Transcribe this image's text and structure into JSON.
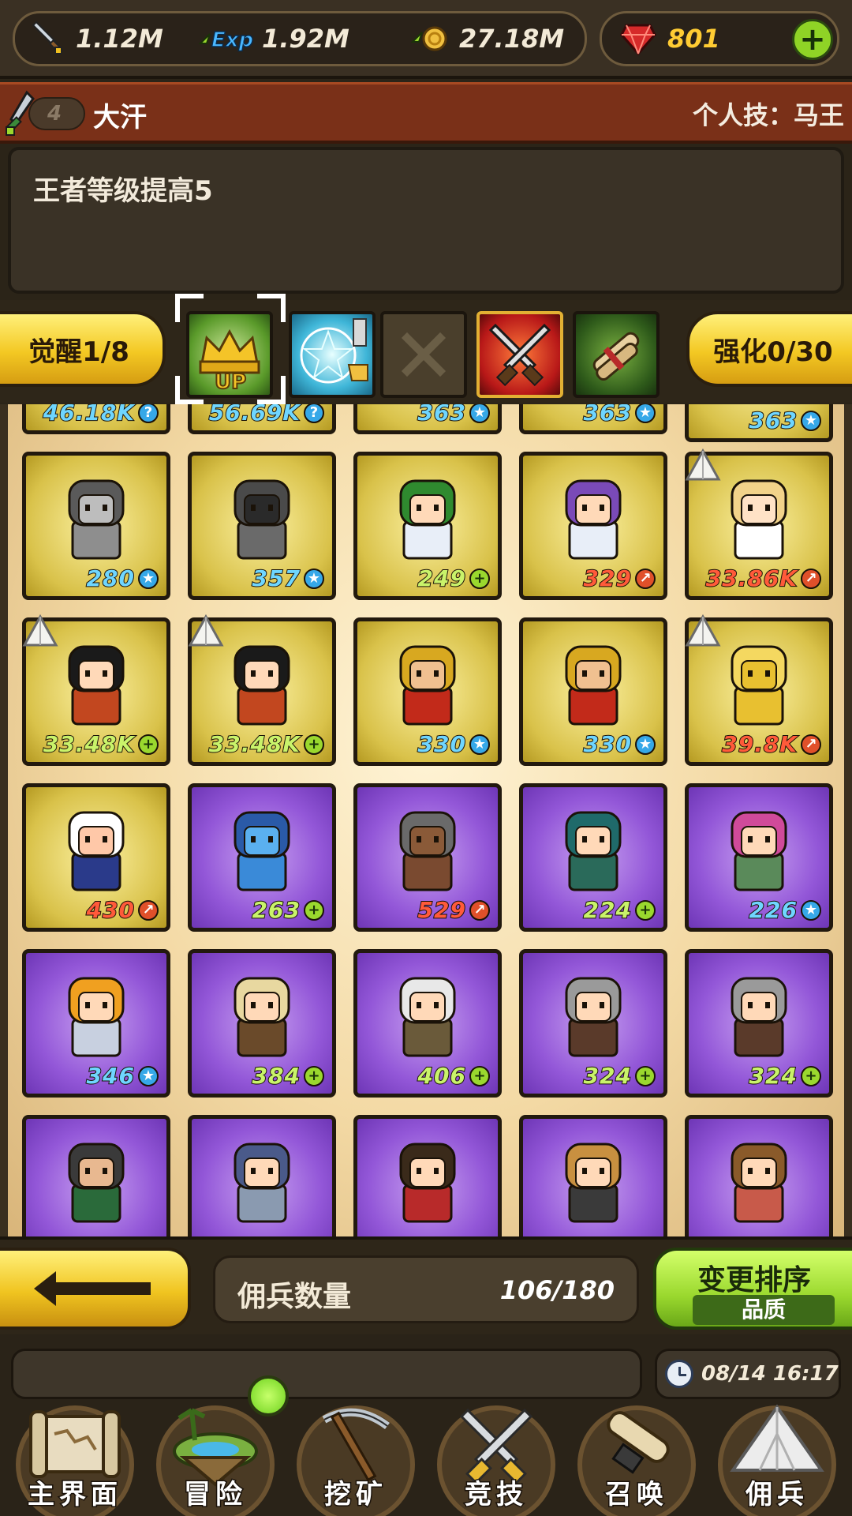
{
  "resources": {
    "attack": {
      "icon": "sword-icon",
      "value": "1.12M"
    },
    "exp": {
      "icon": "exp-icon",
      "value": "1.92M"
    },
    "gold": {
      "icon": "gold-icon",
      "value": "27.18M"
    },
    "gems": {
      "icon": "ruby-icon",
      "value": "801"
    },
    "add_icon": "plus-icon",
    "add_label": "+"
  },
  "hero": {
    "level": "4",
    "name": "大汗",
    "skill_label": "个人技：马王"
  },
  "description": "王者等级提高5",
  "skill_row": {
    "awaken_label": "觉醒1/8",
    "enhance_label": "强化0/30",
    "slots": [
      "crown-up-icon",
      "magic-circle-handshake-icon",
      "empty-slot-icon",
      "crossed-swords-icon",
      "scroll-bundle-icon"
    ]
  },
  "grid": {
    "top_partial": [
      "46.18K",
      "56.69K",
      "363",
      "363",
      "363"
    ],
    "cards": [
      {
        "value": "280",
        "type": "blue",
        "frame": "gold",
        "sprite": "armored-knight",
        "body": "#8e8e8e",
        "hair": "#5a5a5a",
        "face": "#bdbdbd",
        "tent": false
      },
      {
        "value": "357",
        "type": "blue",
        "frame": "gold",
        "sprite": "hooded-figure",
        "body": "#6a6a6a",
        "hair": "#4a4a4a",
        "face": "#2a2a2a",
        "tent": false
      },
      {
        "value": "249",
        "type": "green",
        "frame": "gold",
        "sprite": "green-hair-girl",
        "body": "#e8eef8",
        "hair": "#2f8a2f",
        "face": "#ffd9b8",
        "tent": false
      },
      {
        "value": "329",
        "type": "red",
        "frame": "gold",
        "sprite": "purple-hair-girl",
        "body": "#e8eef8",
        "hair": "#7a4ab8",
        "face": "#ffd9b8",
        "tent": false
      },
      {
        "value": "33.86K",
        "type": "red",
        "frame": "gold",
        "sprite": "blonde-girl",
        "body": "#ffffff",
        "hair": "#f2d38a",
        "face": "#ffe2c6",
        "tent": true
      },
      {
        "value": "33.48K",
        "type": "green",
        "frame": "gold",
        "sprite": "black-hair-soldier",
        "body": "#c2471f",
        "hair": "#1a1a1a",
        "face": "#ffd9b8",
        "tent": true
      },
      {
        "value": "33.48K",
        "type": "green",
        "frame": "gold",
        "sprite": "black-hair-soldier",
        "body": "#c2471f",
        "hair": "#1a1a1a",
        "face": "#ffd9b8",
        "tent": true
      },
      {
        "value": "330",
        "type": "blue",
        "frame": "gold",
        "sprite": "red-armor-warrior",
        "body": "#c22a1a",
        "hair": "#d8a820",
        "face": "#f0c090",
        "tent": false
      },
      {
        "value": "330",
        "type": "blue",
        "frame": "gold",
        "sprite": "red-armor-warrior",
        "body": "#c22a1a",
        "hair": "#d8a820",
        "face": "#f0c090",
        "tent": false
      },
      {
        "value": "39.8K",
        "type": "red",
        "frame": "gold",
        "sprite": "golden-star",
        "body": "#e8c030",
        "hair": "#f4d860",
        "face": "#e8c030",
        "tent": true
      },
      {
        "value": "430",
        "type": "red",
        "frame": "gold",
        "sprite": "maid-girl",
        "body": "#2a3a8a",
        "hair": "#ffffff",
        "face": "#ffc8a8",
        "tent": false
      },
      {
        "value": "263",
        "type": "green",
        "frame": "purple",
        "sprite": "blue-dragon",
        "body": "#3a8ad8",
        "hair": "#2a5aa8",
        "face": "#5ab0f0",
        "tent": false
      },
      {
        "value": "529",
        "type": "red",
        "frame": "purple",
        "sprite": "dark-skin-warrior",
        "body": "#7a4a30",
        "hair": "#6a6a6a",
        "face": "#8a5a38",
        "tent": false
      },
      {
        "value": "224",
        "type": "green",
        "frame": "purple",
        "sprite": "teal-hair-man",
        "body": "#2a6a5a",
        "hair": "#1f6a6a",
        "face": "#ffd9b8",
        "tent": false
      },
      {
        "value": "226",
        "type": "blue",
        "frame": "purple",
        "sprite": "pink-hair-girl",
        "body": "#5a8a5a",
        "hair": "#d04a9a",
        "face": "#ffd9b8",
        "tent": false
      },
      {
        "value": "346",
        "type": "blue",
        "frame": "purple",
        "sprite": "orange-hair-knight",
        "body": "#c8d0e0",
        "hair": "#f0a020",
        "face": "#ffd9b8",
        "tent": false
      },
      {
        "value": "384",
        "type": "green",
        "frame": "purple",
        "sprite": "horse-rider-blonde",
        "body": "#6a4a2a",
        "hair": "#e8d8a0",
        "face": "#ffd9b8",
        "tent": false
      },
      {
        "value": "406",
        "type": "green",
        "frame": "purple",
        "sprite": "horse-rider-white",
        "body": "#6a5a3a",
        "hair": "#e8e8e8",
        "face": "#ffd9b8",
        "tent": false
      },
      {
        "value": "324",
        "type": "green",
        "frame": "purple",
        "sprite": "horse-rider-grey",
        "body": "#5a3a2a",
        "hair": "#9a9a9a",
        "face": "#ffd9b8",
        "tent": false
      },
      {
        "value": "324",
        "type": "green",
        "frame": "purple",
        "sprite": "horse-rider-grey",
        "body": "#5a3a2a",
        "hair": "#9a9a9a",
        "face": "#ffd9b8",
        "tent": false
      },
      {
        "value": "",
        "type": "none",
        "frame": "purple",
        "sprite": "bearded-general",
        "body": "#2a6a3a",
        "hair": "#3a3a3a",
        "face": "#e8b890",
        "tent": false
      },
      {
        "value": "",
        "type": "none",
        "frame": "purple",
        "sprite": "blue-hair-knight",
        "body": "#8a9ab0",
        "hair": "#4a5a8a",
        "face": "#ffd9b8",
        "tent": false
      },
      {
        "value": "",
        "type": "none",
        "frame": "purple",
        "sprite": "red-robe-princess",
        "body": "#b82a2a",
        "hair": "#3a2a1a",
        "face": "#ffd9b8",
        "tent": false
      },
      {
        "value": "",
        "type": "none",
        "frame": "purple",
        "sprite": "winged-warrior",
        "body": "#3a3a3a",
        "hair": "#c89040",
        "face": "#ffd9b8",
        "tent": false
      },
      {
        "value": "",
        "type": "none",
        "frame": "purple",
        "sprite": "goggles-engineer",
        "body": "#c85a4a",
        "hair": "#8a5a2a",
        "face": "#ffd9b8",
        "tent": false
      }
    ]
  },
  "controls": {
    "back_icon": "arrow-left-icon",
    "count_label": "佣兵数量",
    "count_value": "106/180",
    "sort_label": "变更排序",
    "sort_value": "品质"
  },
  "status": {
    "clock_icon": "clock-icon",
    "datetime": "08/14 16:17"
  },
  "nav": [
    {
      "label": "主界面",
      "icon": "map-scroll-icon"
    },
    {
      "label": "冒险",
      "icon": "floating-island-icon"
    },
    {
      "label": "挖矿",
      "icon": "pickaxe-icon"
    },
    {
      "label": "竞技",
      "icon": "crossed-swords-icon"
    },
    {
      "label": "召唤",
      "icon": "summon-scroll-icon"
    },
    {
      "label": "佣兵",
      "icon": "tent-icon"
    }
  ],
  "colors": {
    "gold_frame": "#d9c24a",
    "purple_frame": "#9357d8",
    "accent_green": "#9ad82e",
    "accent_yellow": "#f3c823"
  }
}
